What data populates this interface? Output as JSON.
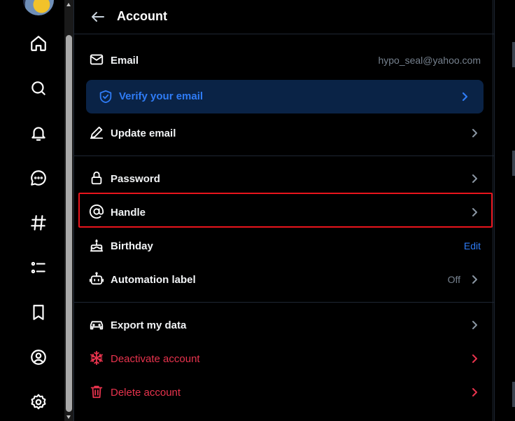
{
  "header": {
    "title": "Account"
  },
  "account": {
    "email_label": "Email",
    "email_value": "hypo_seal@yahoo.com",
    "verify_label": "Verify your email",
    "update_email_label": "Update email",
    "password_label": "Password",
    "handle_label": "Handle",
    "birthday_label": "Birthday",
    "birthday_action": "Edit",
    "automation_label": "Automation label",
    "automation_value": "Off",
    "export_label": "Export my data",
    "deactivate_label": "Deactivate account",
    "delete_label": "Delete account"
  },
  "colors": {
    "accent": "#2f7cf6",
    "danger": "#e8334d",
    "highlight": "#e8141c",
    "verify_bg": "#0a2346"
  },
  "nav": {
    "icons": [
      "home-icon",
      "search-icon",
      "bell-icon",
      "chat-icon",
      "hashtag-icon",
      "list-icon",
      "bookmark-icon",
      "profile-icon",
      "gear-icon"
    ]
  }
}
